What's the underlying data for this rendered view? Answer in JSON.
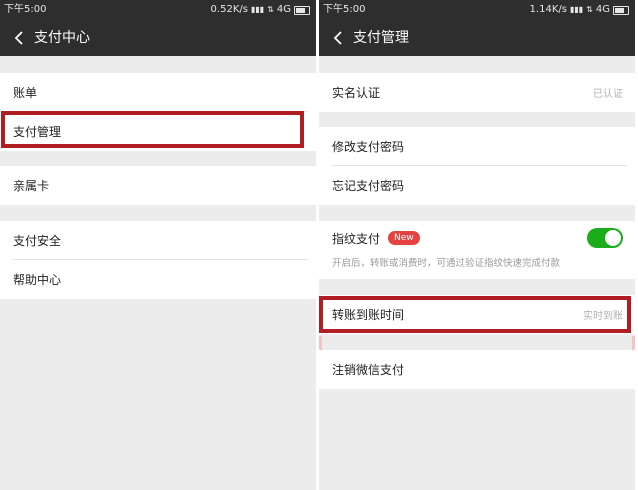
{
  "left": {
    "status": {
      "time": "下午5:00",
      "speed": "0.52K/s",
      "network": "4G"
    },
    "title": "支付中心",
    "items": [
      {
        "label": "账单"
      },
      {
        "label": "支付管理"
      },
      {
        "label": "亲属卡"
      },
      {
        "label": "支付安全"
      },
      {
        "label": "帮助中心"
      }
    ]
  },
  "right": {
    "status": {
      "time": "下午5:00",
      "speed": "1.14K/s",
      "network": "4G"
    },
    "title": "支付管理",
    "verification": {
      "label": "实名认证",
      "value": "已认证"
    },
    "password_items": [
      {
        "label": "修改支付密码"
      },
      {
        "label": "忘记支付密码"
      }
    ],
    "fingerprint": {
      "label": "指纹支付",
      "badge": "New",
      "enabled": true,
      "description": "开启后，转账或消费时，可通过验证指纹快速完成付款"
    },
    "transfer_time": {
      "label": "转账到账时间",
      "value": "实时到账"
    },
    "cancel": {
      "label": "注销微信支付"
    }
  },
  "colors": {
    "titlebar": "#2e2e2e",
    "highlight": "#b01e24",
    "toggle_on": "#1aad19",
    "badge": "#e64340"
  }
}
